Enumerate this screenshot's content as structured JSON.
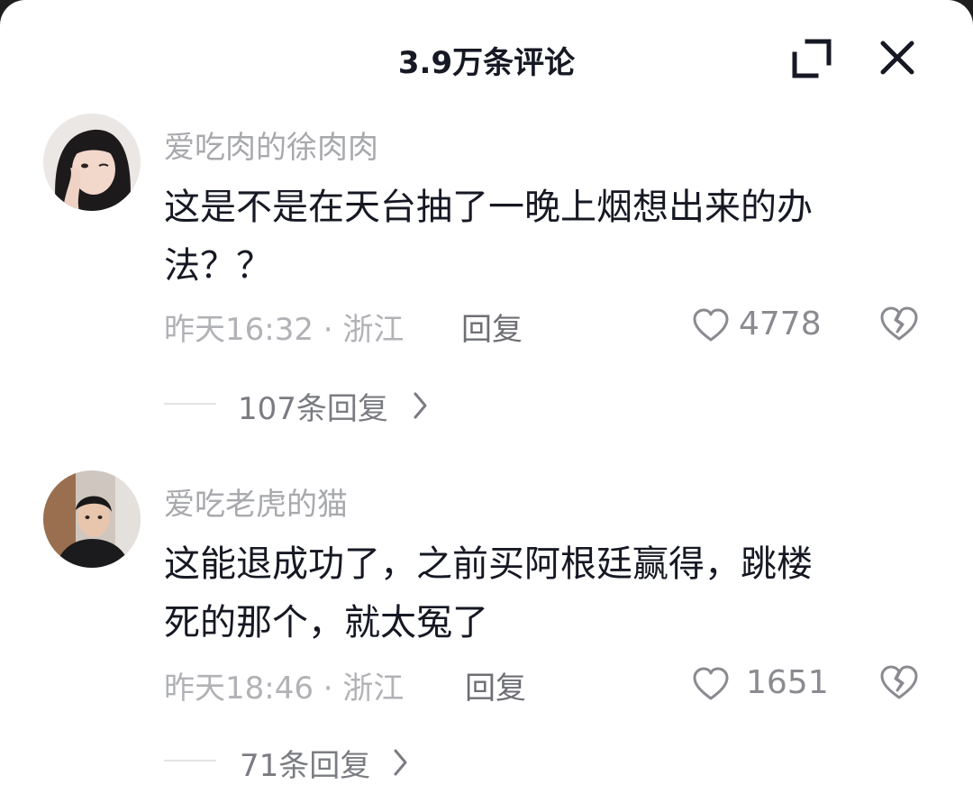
{
  "header": {
    "title": "3.9万条评论",
    "expand_icon": "expand-icon",
    "close_icon": "close-icon"
  },
  "comments": [
    {
      "username": "爱吃肉的徐肉肉",
      "avatar": "avatar-photo",
      "content_lines": [
        "这是不是在天台抽了一晚上烟想出来的办",
        "法？？"
      ],
      "meta": "昨天16:32 · 浙江",
      "reply_label": "回复",
      "likes": "4778",
      "thread_label": "107条回复"
    },
    {
      "username": "爱吃老虎的猫",
      "avatar": "avatar-photo",
      "content_lines": [
        "这能退成功了，之前买阿根廷赢得，跳楼",
        "死的那个，就太冤了"
      ],
      "meta": "昨天18:46 · 浙江",
      "reply_label": "回复",
      "likes": "1651",
      "thread_label": "71条回复"
    }
  ],
  "colors": {
    "text_primary": "#161823",
    "text_secondary": "#a8a9ad",
    "background": "#ffffff"
  }
}
